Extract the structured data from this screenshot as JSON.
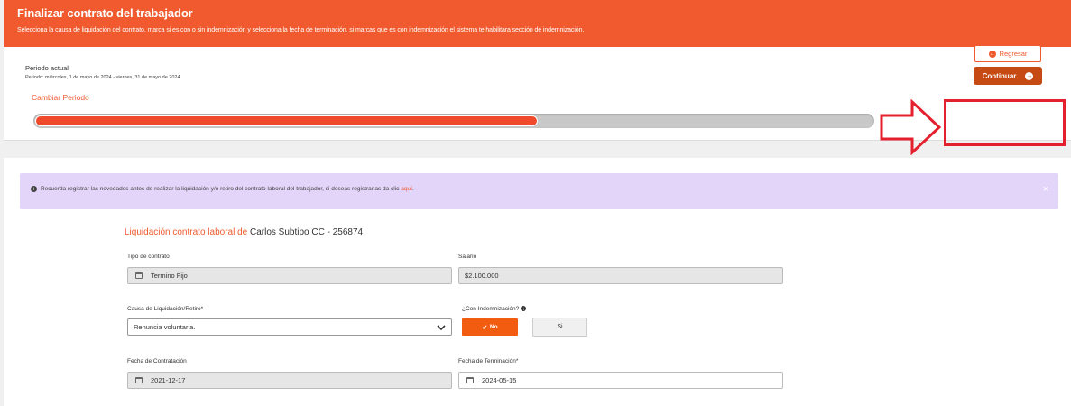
{
  "header": {
    "title": "Finalizar contrato del trabajador",
    "subtitle": "Selecciona la causa de liquidación del contrato, marca si es con o sin indemnización y selecciona la fecha de terminación, si marcas que es con indemnización el sistema te habilitara sección de indemnización."
  },
  "period": {
    "label": "Periodo actual",
    "range": "Periodo: miércoles, 1 de mayo de 2024 - viernes, 31 de mayo de 2024",
    "change_label": "Cambiar Periodo",
    "progress_fraction": 0.6
  },
  "actions": {
    "back_label": "Regresar",
    "continue_label": "Continuar"
  },
  "alert": {
    "message": "Recuerda registrar las novedades antes de realizar la liquidación y/o retiro del contrato laboral del trabajador, si deseas registrarlas da clic ",
    "link": "aquí",
    "after": ".",
    "close": "×"
  },
  "form": {
    "title_accent": "Liquidación contrato laboral de",
    "worker_name": "Carlos Subtipo CC - 256874",
    "contract_type_label": "Tipo de contrato",
    "contract_type_value": "Termino Fijo",
    "salary_label": "Salario",
    "salary_value": "$2.100.000",
    "cause_label": "Causa de Liquidación/Retiro*",
    "cause_value": "Renuncia voluntaria.",
    "indemnity_label": "¿Con Indemnización?",
    "indemnity_no": "No",
    "indemnity_si": "Si",
    "hire_date_label": "Fecha de Contratación",
    "hire_date_value": "2021-12-17",
    "end_date_label": "Fecha de Terminación*",
    "end_date_value": "2024-05-15"
  },
  "colors": {
    "accent": "#f05a2e",
    "continue_bg": "#c54a14",
    "highlight": "#e5202e",
    "alert_bg": "#e3d4f9"
  }
}
